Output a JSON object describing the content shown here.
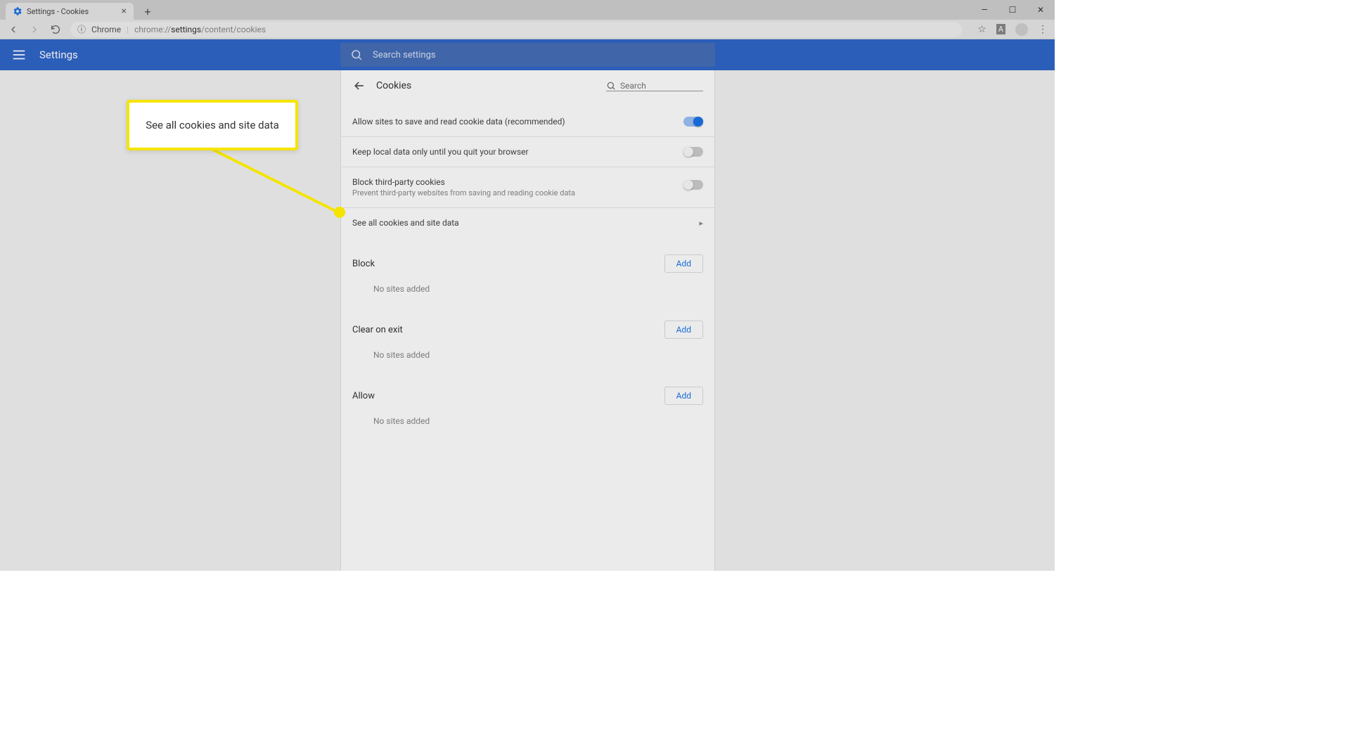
{
  "window": {
    "tab_title": "Settings - Cookies"
  },
  "toolbar": {
    "chrome_label": "Chrome",
    "url_plain1": "chrome://",
    "url_bold": "settings",
    "url_plain2": "/content/cookies"
  },
  "header": {
    "title": "Settings",
    "search_placeholder": "Search settings"
  },
  "page": {
    "title": "Cookies",
    "search_placeholder": "Search",
    "rows": {
      "allow_sites": "Allow sites to save and read cookie data (recommended)",
      "keep_local": "Keep local data only until you quit your browser",
      "block_third": "Block third-party cookies",
      "block_third_sub": "Prevent third-party websites from saving and reading cookie data",
      "see_all": "See all cookies and site data"
    },
    "sections": {
      "block": "Block",
      "clear_on_exit": "Clear on exit",
      "allow": "Allow",
      "add_label": "Add",
      "empty": "No sites added"
    }
  },
  "callout": {
    "text": "See all cookies and site data"
  }
}
